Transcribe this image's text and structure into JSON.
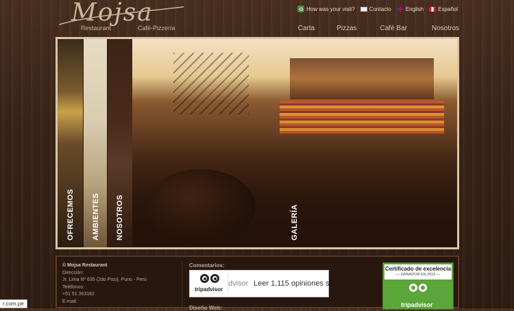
{
  "brand": {
    "logo_text": "Mojsa",
    "sub_left": "Restaurant",
    "sub_right": "Café-Pizzería"
  },
  "topbar": {
    "visit": "How was your visit?",
    "contact": "Contacto",
    "english": "English",
    "spanish": "Español"
  },
  "nav": [
    "Carta",
    "Pizzas",
    "Café Bar",
    "Nosotros"
  ],
  "hero": {
    "tabs": [
      "OFRECEMOS",
      "AMBIENTES",
      "NOSOTROS",
      "GALERÍA"
    ]
  },
  "footer": {
    "copyright": "© Mojsa Restaurant",
    "address_label": "Dirección:",
    "address": "Jr. Lima Nº 635 (2do Piso), Puno - Perú",
    "phone_label": "Teléfonos:",
    "phone": "+51 51 363182",
    "email_label": "E-mail:",
    "comments_title": "Comentarios:",
    "design_title": "Diseño Web:",
    "tripadvisor_word": "tripadvisor",
    "tripadvisor_cut": "dvisor",
    "reviews_text": "Leer 1,115 opiniones s",
    "cert_title": "Certificado de excelencia",
    "cert_sub": "— GANADOR EN 2015 —",
    "cert_brand": "tripadvisor"
  },
  "status_tip": "r.com.pe",
  "colors": {
    "background": "#3a2418",
    "accent_tan": "#c9b89b",
    "tripadvisor_green": "#5ba53a"
  }
}
